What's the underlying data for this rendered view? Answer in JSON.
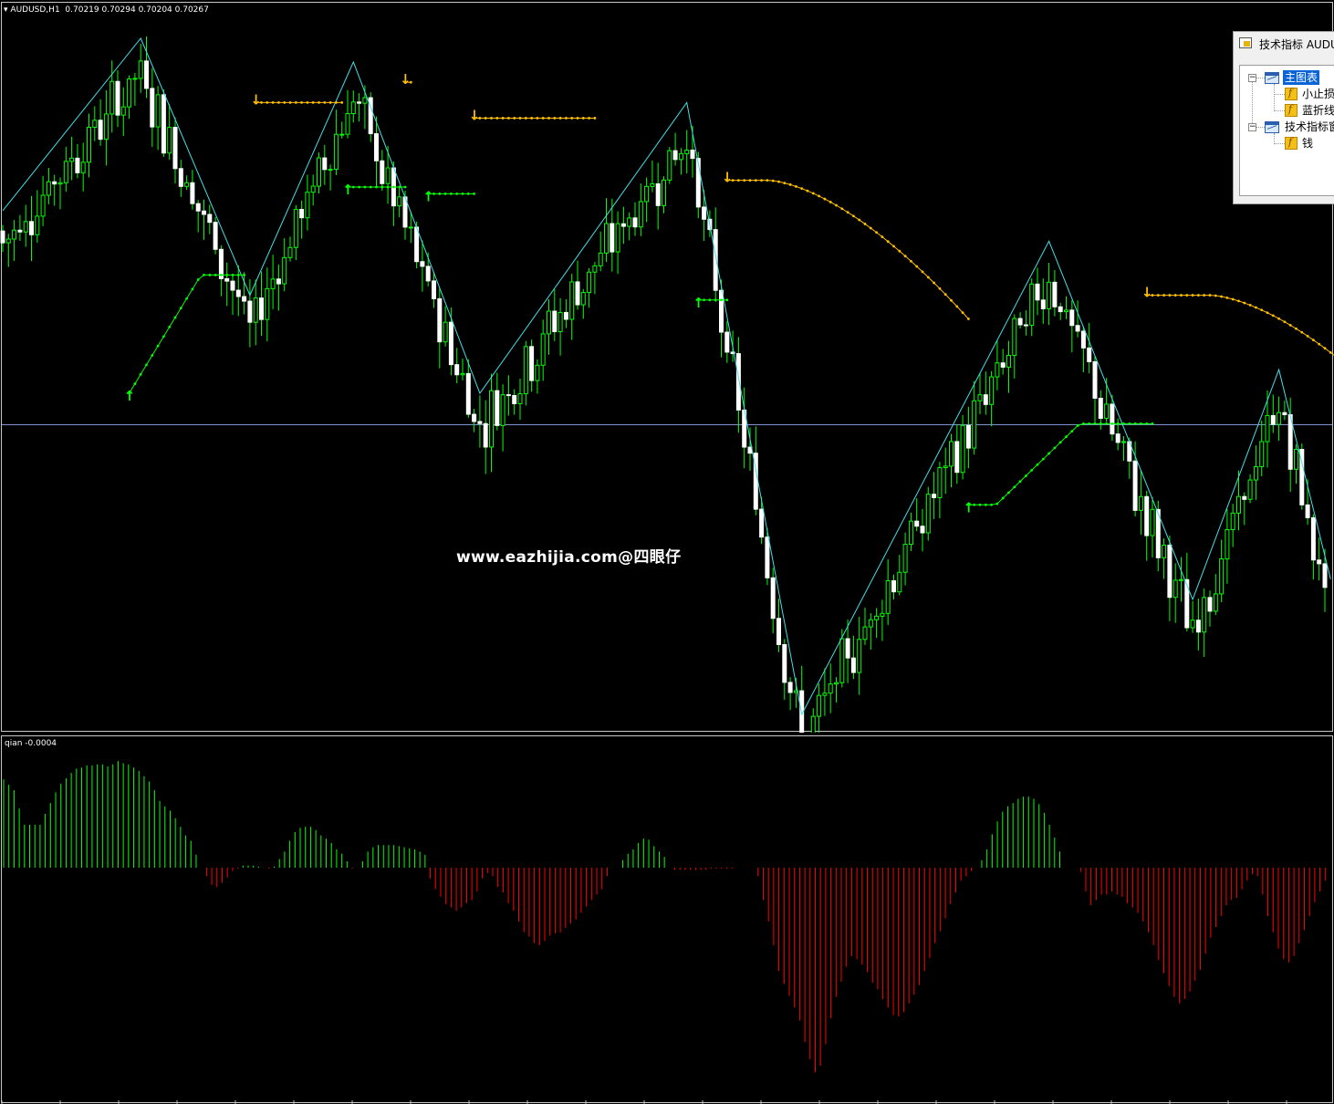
{
  "chart_header": {
    "symbol_info": "AUDUSD,H1",
    "ohlc": "0.70219 0.70294 0.70204 0.70267",
    "dropdown_icon": "triangle-down-icon"
  },
  "subwindow": {
    "label": "qian -0.0004"
  },
  "watermark": "www.eazhijia.com@四眼仔",
  "colors": {
    "background": "#000000",
    "candle_body": "#ffffff",
    "candle_wick": "#00ff00",
    "zigzag": "#40e0e8",
    "trail_down": "#ffbf00",
    "trail_up": "#00ff00",
    "hist_positive": "#00ff00",
    "hist_negative": "#ff0000",
    "hline": "#8090d0"
  },
  "navigator": {
    "title": "技术指标 AUDU",
    "tree": [
      {
        "label": "主图表",
        "icon": "window-icon",
        "selected": true,
        "children": [
          {
            "label": "小止损",
            "icon": "indicator-icon"
          },
          {
            "label": "蓝折线",
            "icon": "indicator-icon"
          }
        ]
      },
      {
        "label": "技术指标窗",
        "icon": "window-icon",
        "selected": false,
        "children": [
          {
            "label": "钱",
            "icon": "indicator-icon"
          }
        ]
      }
    ]
  },
  "chart_data": [
    {
      "type": "candlestick",
      "symbol": "AUDUSD",
      "timeframe": "H1",
      "zigzag_pivots": [
        [
          0,
          0.745
        ],
        [
          24,
          1.0
        ],
        [
          43,
          0.62
        ],
        [
          61,
          0.965
        ],
        [
          83,
          0.475
        ],
        [
          119,
          0.905
        ],
        [
          139,
          0.0
        ],
        [
          182,
          0.7
        ],
        [
          207,
          0.17
        ],
        [
          222,
          0.51
        ],
        [
          231,
          0.2
        ]
      ],
      "stop_trail_down": [
        {
          "start": 44,
          "end": 59,
          "level": 0.905
        },
        {
          "start": 70,
          "end": 71,
          "level": 0.935
        },
        {
          "start": 82,
          "end": 103,
          "level": 0.882,
          "taper_to": 0.825,
          "taper_from": 103,
          "taper_end": 120
        },
        {
          "start": 126,
          "end": 168,
          "level": 0.79,
          "drop_to": 0.585,
          "drop_from": 133
        },
        {
          "start": 199,
          "end": 240,
          "level": 0.62,
          "drop_to": 0.47,
          "drop_from": 210
        }
      ],
      "stop_trail_up": [
        {
          "start": 22,
          "end": 42,
          "level": 0.65,
          "rise_from": 0.475
        },
        {
          "start": 60,
          "end": 70,
          "level": 0.78
        },
        {
          "start": 74,
          "end": 82,
          "level": 0.77
        },
        {
          "start": 121,
          "end": 126,
          "level": 0.613
        },
        {
          "start": 168,
          "end": 200,
          "level": 0.31,
          "rise_to": 0.43
        }
      ]
    },
    {
      "type": "bar",
      "name": "qian",
      "values": [
        0.82,
        0.77,
        0.72,
        0.55,
        0.4,
        0.4,
        0.4,
        0.4,
        0.5,
        0.6,
        0.7,
        0.78,
        0.83,
        0.88,
        0.92,
        0.93,
        0.95,
        0.95,
        0.96,
        0.96,
        0.94,
        0.96,
        0.99,
        0.97,
        0.96,
        0.93,
        0.9,
        0.85,
        0.8,
        0.72,
        0.62,
        0.57,
        0.53,
        0.46,
        0.38,
        0.3,
        0.25,
        0.12,
        0.0,
        -0.08,
        -0.16,
        -0.18,
        -0.14,
        -0.09,
        -0.03,
        -0.01,
        0.02,
        0.02,
        0.02,
        0.01,
        0.0,
        -0.01,
        0.01,
        0.08,
        0.15,
        0.25,
        0.33,
        0.37,
        0.38,
        0.38,
        0.35,
        0.3,
        0.27,
        0.23,
        0.17,
        0.13,
        0.06,
        -0.01,
        0.0,
        0.06,
        0.15,
        0.19,
        0.21,
        0.21,
        0.21,
        0.21,
        0.2,
        0.19,
        0.18,
        0.17,
        0.15,
        0.12,
        -0.1,
        -0.2,
        -0.27,
        -0.34,
        -0.37,
        -0.4,
        -0.37,
        -0.33,
        -0.3,
        -0.22,
        -0.1,
        -0.05,
        -0.08,
        -0.18,
        -0.23,
        -0.33,
        -0.4,
        -0.5,
        -0.6,
        -0.64,
        -0.7,
        -0.72,
        -0.68,
        -0.63,
        -0.61,
        -0.6,
        -0.56,
        -0.52,
        -0.48,
        -0.42,
        -0.36,
        -0.3,
        -0.25,
        -0.2,
        -0.08,
        0.0,
        0.0,
        0.07,
        0.13,
        0.17,
        0.23,
        0.27,
        0.26,
        0.2,
        0.15,
        0.1,
        0.0,
        -0.02,
        -0.02,
        -0.02,
        -0.02,
        -0.02,
        -0.02,
        -0.02,
        -0.01,
        -0.01,
        -0.01,
        -0.01,
        -0.01,
        0.0,
        0.0,
        0.0,
        0.0,
        -0.08,
        -0.3,
        -0.5,
        -0.72,
        -0.96,
        -1.08,
        -1.19,
        -1.3,
        -1.42,
        -1.62,
        -1.78,
        -1.9,
        -1.84,
        -1.64,
        -1.4,
        -1.2,
        -1.06,
        -0.92,
        -0.82,
        -0.85,
        -0.9,
        -0.97,
        -1.07,
        -1.13,
        -1.22,
        -1.3,
        -1.37,
        -1.38,
        -1.34,
        -1.26,
        -1.18,
        -1.09,
        -0.96,
        -0.84,
        -0.7,
        -0.59,
        -0.47,
        -0.34,
        -0.23,
        -0.12,
        -0.08,
        -0.03,
        0.0,
        0.07,
        0.17,
        0.31,
        0.43,
        0.52,
        0.57,
        0.6,
        0.64,
        0.66,
        0.66,
        0.64,
        0.59,
        0.51,
        0.4,
        0.28,
        0.15,
        0.0,
        0.0,
        0.0,
        -0.04,
        -0.22,
        -0.35,
        -0.3,
        -0.25,
        -0.25,
        -0.22,
        -0.25,
        -0.27,
        -0.33,
        -0.37,
        -0.42,
        -0.5,
        -0.6,
        -0.72,
        -0.86,
        -0.98,
        -1.1,
        -1.2,
        -1.26,
        -1.22,
        -1.15,
        -1.05,
        -0.95,
        -0.8,
        -0.65,
        -0.55,
        -0.45,
        -0.35,
        -0.3,
        -0.28,
        -0.2,
        -0.12,
        -0.06,
        -0.08,
        -0.25,
        -0.45,
        -0.6,
        -0.75,
        -0.85,
        -0.88,
        -0.82,
        -0.7,
        -0.58,
        -0.45,
        -0.32,
        -0.22,
        -0.12
      ]
    }
  ]
}
